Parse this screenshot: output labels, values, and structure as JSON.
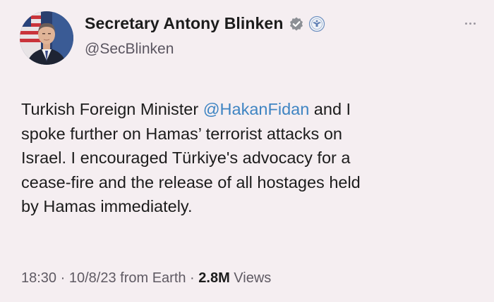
{
  "author": {
    "display_name": "Secretary Antony Blinken",
    "handle": "@SecBlinken"
  },
  "tweet": {
    "lines": [
      {
        "before": "Turkish Foreign Minister ",
        "mention": "@HakanFidan",
        "after": " and I"
      },
      {
        "text": "spoke further on Hamas’ terrorist attacks on"
      },
      {
        "text": "Israel. I encouraged Türkiye's advocacy for a"
      },
      {
        "text": "cease-fire and the release of all hostages held"
      },
      {
        "text": "by Hamas immediately."
      }
    ]
  },
  "meta": {
    "time": "18:30",
    "sep1": " · ",
    "date": "10/8/23",
    "source": " from Earth",
    "sep2": " · ",
    "views_count": "2.8M",
    "views_label": " Views"
  },
  "colors": {
    "background": "#f5eef1",
    "mention": "#3e84c2",
    "verified": "#8c8f95"
  },
  "icons": {
    "verified": "verified-badge-icon",
    "seal": "state-department-seal-icon",
    "more": "more-icon"
  }
}
